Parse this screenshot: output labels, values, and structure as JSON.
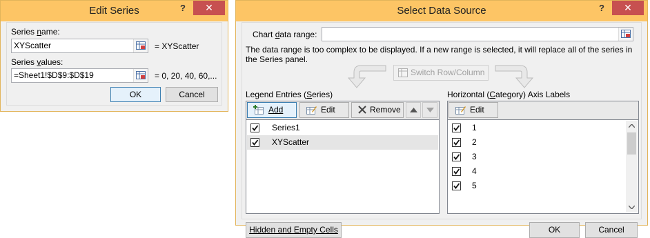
{
  "edit_series": {
    "title": "Edit Series",
    "help": "?",
    "close": "✕",
    "series_name_label_pre": "Series ",
    "series_name_label_u": "n",
    "series_name_label_post": "ame:",
    "series_name_value": "XYScatter",
    "series_name_preview": "= XYScatter",
    "series_values_label_pre": "Series ",
    "series_values_label_u": "v",
    "series_values_label_post": "alues:",
    "series_values_value": "=Sheet1!$D$9:$D$19",
    "series_values_preview": "= 0, 20, 40, 60,...",
    "ok": "OK",
    "cancel": "Cancel"
  },
  "select_data_source": {
    "title": "Select Data Source",
    "help": "?",
    "close": "✕",
    "chart_range_label_pre": "Chart ",
    "chart_range_label_u": "d",
    "chart_range_label_post": "ata range:",
    "chart_range_value": "",
    "message": "The data range is too complex to be displayed. If a new range is selected, it will replace all of the series in the Series panel.",
    "switch_label": "Switch Row/Column",
    "legend_header_pre": "Legend Entries (",
    "legend_header_u": "S",
    "legend_header_post": "eries)",
    "add": "Add",
    "edit": "Edit",
    "remove": "Remove",
    "series": [
      {
        "label": "Series1",
        "checked": true,
        "selected": false
      },
      {
        "label": "XYScatter",
        "checked": true,
        "selected": true
      }
    ],
    "axis_header_pre": "Horizontal (",
    "axis_header_u": "C",
    "axis_header_post": "ategory) Axis Labels",
    "axis_edit": "Edit",
    "axis_labels": [
      "1",
      "2",
      "3",
      "4",
      "5"
    ],
    "hidden_cells": "Hidden and Empty Cells",
    "ok": "OK",
    "cancel": "Cancel"
  }
}
